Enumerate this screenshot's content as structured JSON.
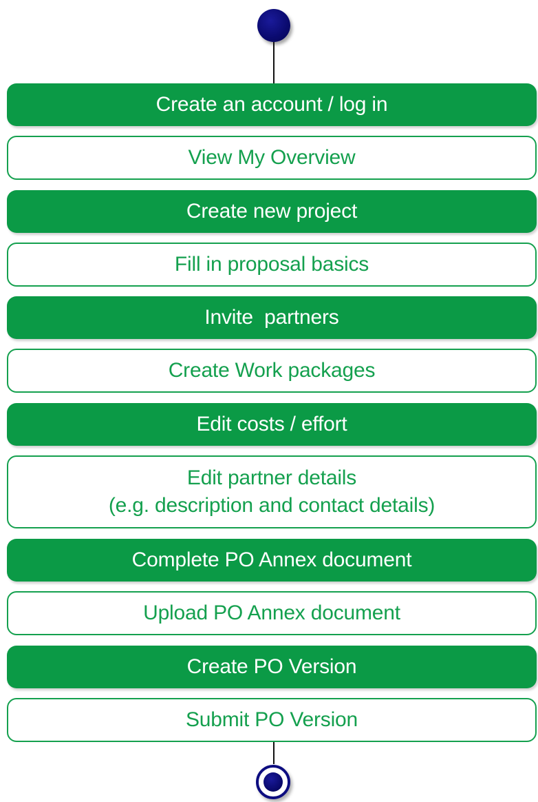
{
  "colors": {
    "filled_step": "#0b9a46",
    "outline_step_border": "#14a04e",
    "outline_step_text": "#14a04e",
    "start_end_node": "#0a0a6e",
    "connector": "#111111"
  },
  "steps": [
    {
      "style": "filled",
      "lines": [
        "Create an account / log in"
      ]
    },
    {
      "style": "outline",
      "lines": [
        "View My Overview"
      ]
    },
    {
      "style": "filled",
      "lines": [
        "Create new project"
      ]
    },
    {
      "style": "outline",
      "lines": [
        "Fill in proposal basics"
      ]
    },
    {
      "style": "filled",
      "lines": [
        "Invite  partners"
      ]
    },
    {
      "style": "outline",
      "lines": [
        "Create Work packages"
      ]
    },
    {
      "style": "filled",
      "lines": [
        "Edit costs / effort"
      ]
    },
    {
      "style": "outline",
      "lines": [
        "Edit partner details",
        "(e.g. description and contact details)"
      ]
    },
    {
      "style": "filled",
      "lines": [
        "Complete PO Annex document"
      ]
    },
    {
      "style": "outline",
      "lines": [
        "Upload PO Annex document"
      ]
    },
    {
      "style": "filled",
      "lines": [
        "Create PO Version"
      ]
    },
    {
      "style": "outline",
      "lines": [
        "Submit PO Version"
      ]
    }
  ]
}
